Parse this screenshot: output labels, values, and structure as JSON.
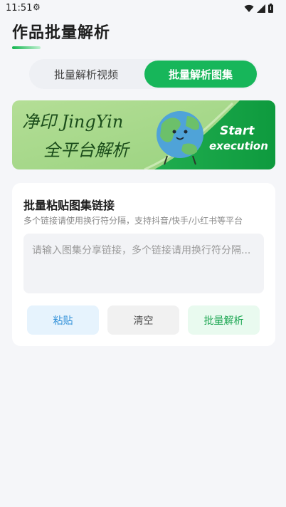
{
  "status_bar": {
    "time": "11:51",
    "gear_icon": "gear-icon",
    "wifi_icon": "wifi-icon",
    "signal_icon": "signal-icon",
    "battery_icon": "battery-icon"
  },
  "header": {
    "title": "作品批量解析"
  },
  "tabs": [
    {
      "label": "批量解析视频",
      "active": false
    },
    {
      "label": "批量解析图集",
      "active": true
    }
  ],
  "banner": {
    "line1": "净印 JingYin",
    "line2": "全平台解析",
    "cta_line1": "Start",
    "cta_line2": "execution",
    "mascot_icon": "earth-mascot-icon"
  },
  "card": {
    "title": "批量粘贴图集链接",
    "description": "多个链接请使用换行符分隔，支持抖音/快手/小红书等平台",
    "input_value": "",
    "input_placeholder": "请输入图集分享链接，多个链接请用换行符分隔...",
    "buttons": {
      "paste": "粘贴",
      "clear": "清空",
      "parse": "批量解析"
    }
  },
  "colors": {
    "accent": "#17b65a",
    "banner_light": "#a8d98a",
    "banner_dark": "#17a84a",
    "paste_text": "#2f8fd8",
    "parse_text": "#1aa550"
  }
}
